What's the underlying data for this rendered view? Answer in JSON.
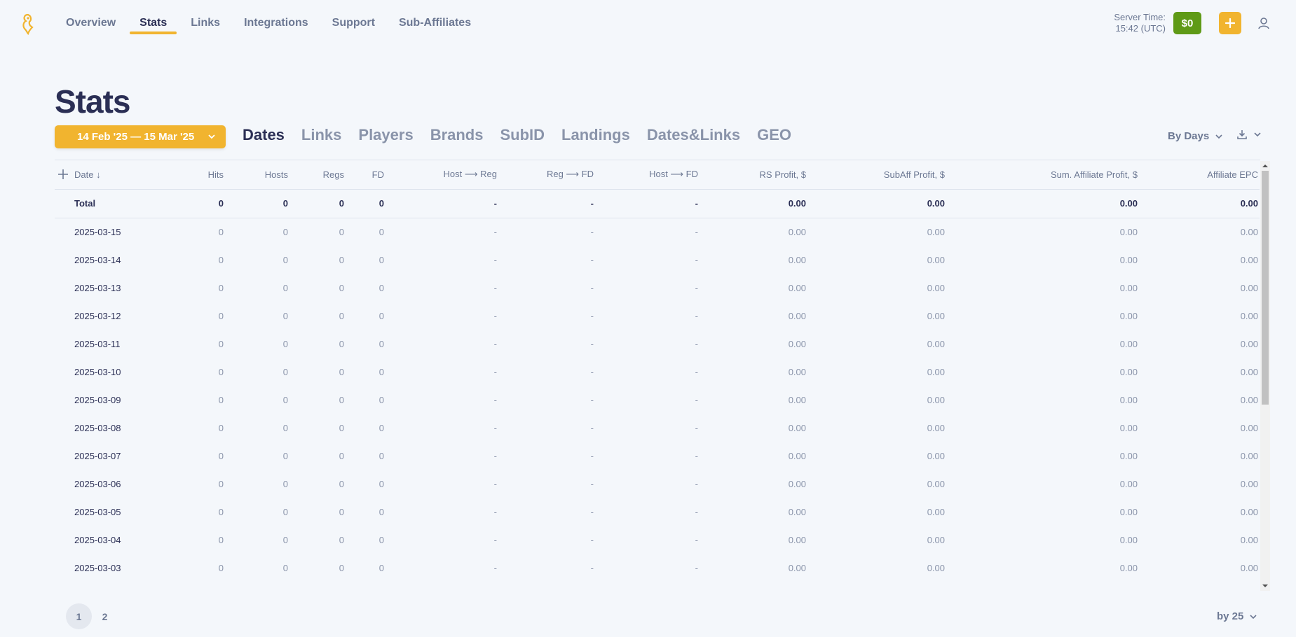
{
  "nav": {
    "items": [
      {
        "label": "Overview",
        "active": false
      },
      {
        "label": "Stats",
        "active": true
      },
      {
        "label": "Links",
        "active": false
      },
      {
        "label": "Integrations",
        "active": false
      },
      {
        "label": "Support",
        "active": false
      },
      {
        "label": "Sub-Affiliates",
        "active": false
      }
    ]
  },
  "header": {
    "server_time_label": "Server Time:",
    "server_time_value": "15:42 (UTC)",
    "balance": "$0",
    "add_icon": "plus-icon",
    "user_icon": "user-icon",
    "accent_color": "#f1b42f",
    "balance_color": "#5f9a16"
  },
  "page": {
    "title": "Stats",
    "date_range": "14 Feb '25 — 15 Mar '25",
    "group_by": "By Days",
    "per_page": "by 25"
  },
  "tabs": [
    {
      "label": "Dates",
      "active": true
    },
    {
      "label": "Links",
      "active": false
    },
    {
      "label": "Players",
      "active": false
    },
    {
      "label": "Brands",
      "active": false
    },
    {
      "label": "SubID",
      "active": false
    },
    {
      "label": "Landings",
      "active": false
    },
    {
      "label": "Dates&Links",
      "active": false
    },
    {
      "label": "GEO",
      "active": false
    }
  ],
  "table": {
    "columns": [
      "Date ↓",
      "Hits",
      "Hosts",
      "Regs",
      "FD",
      "Host ⟶ Reg",
      "Reg ⟶ FD",
      "Host ⟶ FD",
      "RS Profit, $",
      "SubAff Profit, $",
      "Sum. Affiliate Profit, $",
      "Affiliate EPC"
    ],
    "total": [
      "Total",
      "0",
      "0",
      "0",
      "0",
      "-",
      "-",
      "-",
      "0.00",
      "0.00",
      "0.00",
      "0.00"
    ],
    "rows": [
      [
        "2025-03-15",
        "0",
        "0",
        "0",
        "0",
        "-",
        "-",
        "-",
        "0.00",
        "0.00",
        "0.00",
        "0.00"
      ],
      [
        "2025-03-14",
        "0",
        "0",
        "0",
        "0",
        "-",
        "-",
        "-",
        "0.00",
        "0.00",
        "0.00",
        "0.00"
      ],
      [
        "2025-03-13",
        "0",
        "0",
        "0",
        "0",
        "-",
        "-",
        "-",
        "0.00",
        "0.00",
        "0.00",
        "0.00"
      ],
      [
        "2025-03-12",
        "0",
        "0",
        "0",
        "0",
        "-",
        "-",
        "-",
        "0.00",
        "0.00",
        "0.00",
        "0.00"
      ],
      [
        "2025-03-11",
        "0",
        "0",
        "0",
        "0",
        "-",
        "-",
        "-",
        "0.00",
        "0.00",
        "0.00",
        "0.00"
      ],
      [
        "2025-03-10",
        "0",
        "0",
        "0",
        "0",
        "-",
        "-",
        "-",
        "0.00",
        "0.00",
        "0.00",
        "0.00"
      ],
      [
        "2025-03-09",
        "0",
        "0",
        "0",
        "0",
        "-",
        "-",
        "-",
        "0.00",
        "0.00",
        "0.00",
        "0.00"
      ],
      [
        "2025-03-08",
        "0",
        "0",
        "0",
        "0",
        "-",
        "-",
        "-",
        "0.00",
        "0.00",
        "0.00",
        "0.00"
      ],
      [
        "2025-03-07",
        "0",
        "0",
        "0",
        "0",
        "-",
        "-",
        "-",
        "0.00",
        "0.00",
        "0.00",
        "0.00"
      ],
      [
        "2025-03-06",
        "0",
        "0",
        "0",
        "0",
        "-",
        "-",
        "-",
        "0.00",
        "0.00",
        "0.00",
        "0.00"
      ],
      [
        "2025-03-05",
        "0",
        "0",
        "0",
        "0",
        "-",
        "-",
        "-",
        "0.00",
        "0.00",
        "0.00",
        "0.00"
      ],
      [
        "2025-03-04",
        "0",
        "0",
        "0",
        "0",
        "-",
        "-",
        "-",
        "0.00",
        "0.00",
        "0.00",
        "0.00"
      ],
      [
        "2025-03-03",
        "0",
        "0",
        "0",
        "0",
        "-",
        "-",
        "-",
        "0.00",
        "0.00",
        "0.00",
        "0.00"
      ]
    ]
  },
  "pagination": {
    "pages": [
      "1",
      "2"
    ],
    "current": "1"
  }
}
